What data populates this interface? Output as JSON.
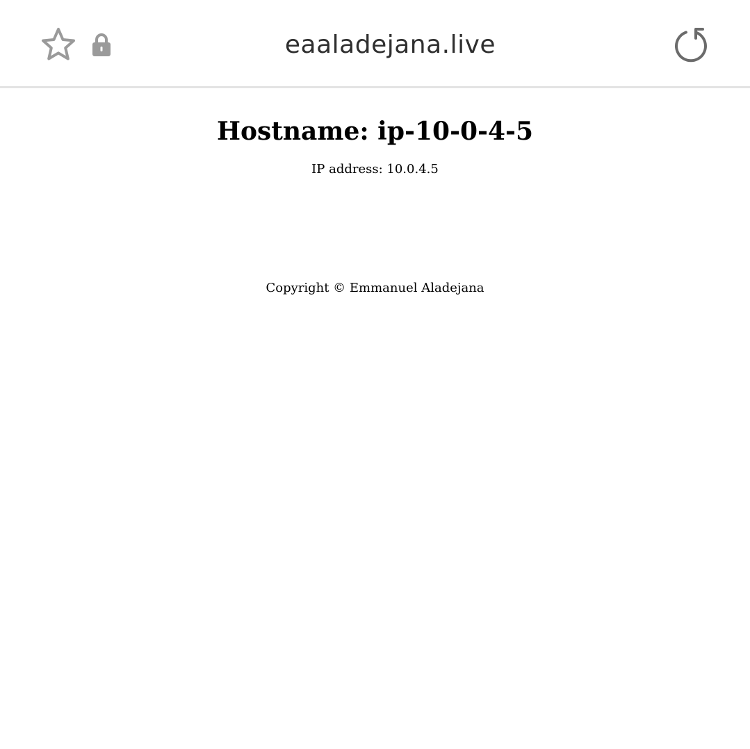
{
  "browser": {
    "url": "eaaladejana.live",
    "icons": {
      "bookmark": "star-icon",
      "security": "lock-icon",
      "reload": "reload-icon"
    },
    "icon_color": "#9a9a9a",
    "reload_color": "#6b6b6b"
  },
  "page": {
    "heading": "Hostname: ip-10-0-4-5",
    "ip_line": "IP address: 10.0.4.5",
    "copyright": "Copyright © Emmanuel Aladejana"
  }
}
